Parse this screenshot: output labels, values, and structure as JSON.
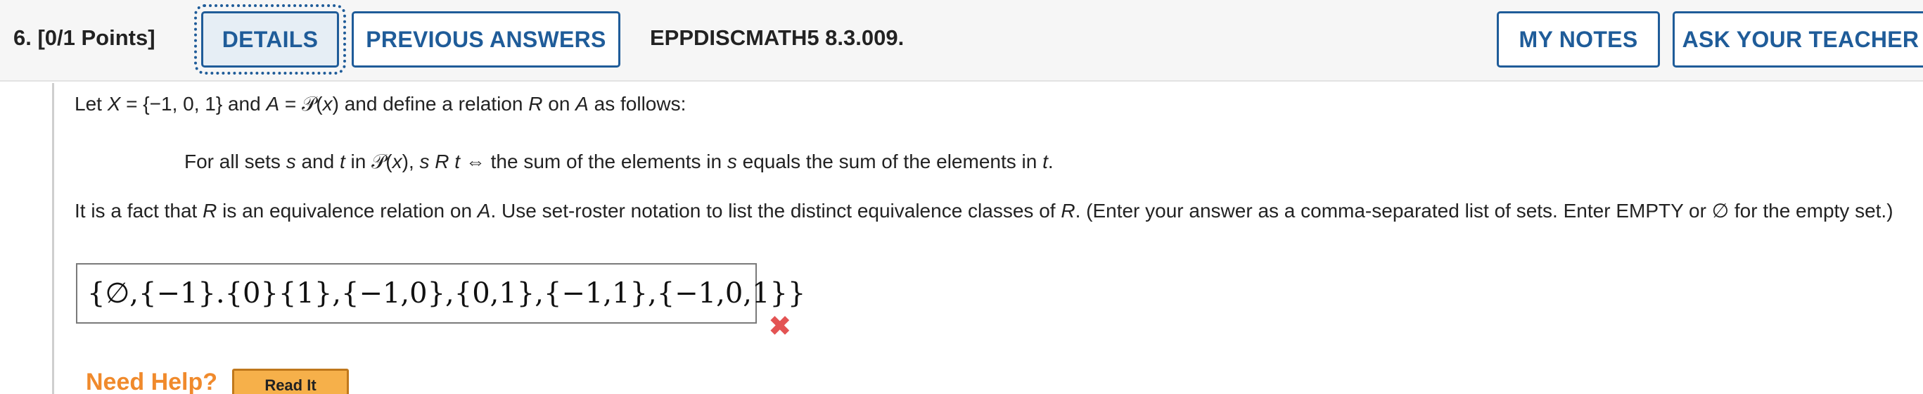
{
  "header": {
    "question_title": "6.  [0/1 Points]",
    "details_label": "DETAILS",
    "previous_answers_label": "PREVIOUS ANSWERS",
    "question_code": "EPPDISCMATH5 8.3.009.",
    "my_notes_label": "MY NOTES",
    "ask_teacher_label": "ASK YOUR TEACHER"
  },
  "question": {
    "line1": {
      "t1": "Let ",
      "X": "X",
      "t2": " = {−1, 0, 1} and ",
      "A": "A",
      "t3": " = 𝒫(",
      "x": "x",
      "t4": ") and define a relation ",
      "R": "R",
      "t5": " on ",
      "A2": "A",
      "t6": " as follows:"
    },
    "line2": {
      "t1": "For all sets ",
      "s": "s",
      "t2": " and ",
      "t": "t",
      "t3": " in 𝒫(",
      "x": "x",
      "t4": "), ",
      "sRt": "s R t",
      "t5": "  ⇔  the sum of the elements in ",
      "s2": "s",
      "t6": " equals the sum of the elements in ",
      "t2v": "t",
      "t7": "."
    },
    "para": {
      "t1": "It is a fact that ",
      "R": "R",
      "t2": " is an equivalence relation on ",
      "A": "A",
      "t3": ". Use set-roster notation to list the distinct equivalence classes of ",
      "R2": "R",
      "t4": ". (Enter your answer as a comma-separated list of sets. Enter EMPTY or ∅ for the empty set.)"
    }
  },
  "answer": {
    "value": "{∅,{−1}.{0}{1},{−1,0},{0,1},{−1,1},{−1,0,1}}",
    "status_icon": "incorrect-x-icon",
    "status_color": "#e35353"
  },
  "help": {
    "label": "Need Help?",
    "read_it_label": "Read It"
  },
  "colors": {
    "accent": "#1f5c99",
    "help_orange": "#f08a2c",
    "read_button": "#f6b04a"
  }
}
